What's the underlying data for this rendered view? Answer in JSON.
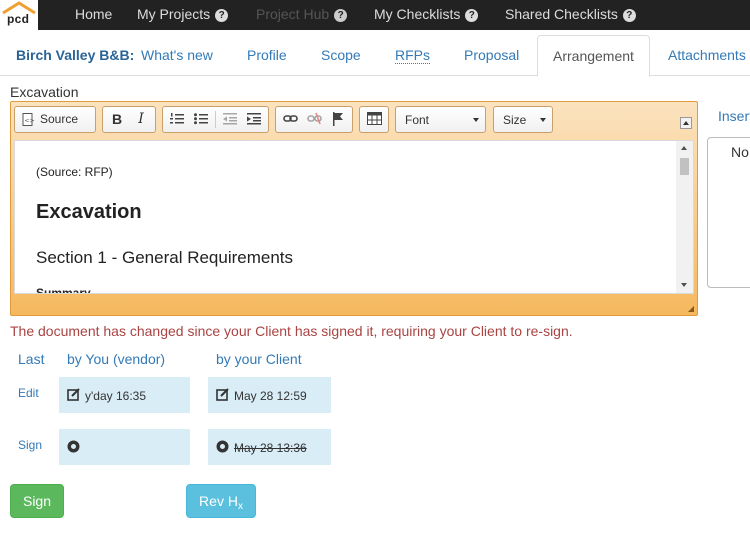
{
  "logo": {
    "text": "pcd"
  },
  "nav": {
    "items": [
      {
        "label": "Home"
      },
      {
        "label": "My Projects"
      },
      {
        "label": "Project Hub"
      },
      {
        "label": "My Checklists"
      },
      {
        "label": "Shared Checklists"
      }
    ],
    "help_glyph": "?"
  },
  "tabs": {
    "project": "Birch Valley B&B",
    "project_sep": ":",
    "items": [
      {
        "label": "What's new"
      },
      {
        "label": "Profile"
      },
      {
        "label": "Scope"
      },
      {
        "label": "RFPs"
      },
      {
        "label": "Proposal"
      },
      {
        "label": "Arrangement"
      },
      {
        "label": "Attachments"
      }
    ],
    "active": "Arrangement"
  },
  "editor": {
    "field_label": "Excavation",
    "toolbar": {
      "source_label": "Source",
      "bold_label": "B",
      "italic_label": "I",
      "font_label": "Font",
      "size_label": "Size"
    },
    "content": {
      "source_note": "(Source: RFP)",
      "heading1": "Excavation",
      "heading2": "Section 1 - General Requirements",
      "subheading": "Summary"
    }
  },
  "side": {
    "insert_label": "Insert",
    "box_text": "No"
  },
  "warning": "The document has changed since your Client has signed it, requiring your Client to re-sign.",
  "signatures": {
    "headers": {
      "last": "Last",
      "vendor": "by You (vendor)",
      "client": "by your Client"
    },
    "rows": [
      {
        "label": "Edit",
        "vendor": "y'day 16:35",
        "client": "May 28 12:59"
      },
      {
        "label": "Sign",
        "vendor": "",
        "client": "May 28 13:36"
      }
    ]
  },
  "buttons": {
    "sign": "Sign",
    "rev": "Rev H",
    "rev_sub": "x"
  },
  "colors": {
    "nav_bg": "#222222",
    "link": "#337ab7",
    "editor_accent": "#f5b85e",
    "warning": "#a94442",
    "cell_bg": "#d9edf7",
    "sign_btn": "#5cb85c",
    "rev_btn": "#5bc0de"
  }
}
